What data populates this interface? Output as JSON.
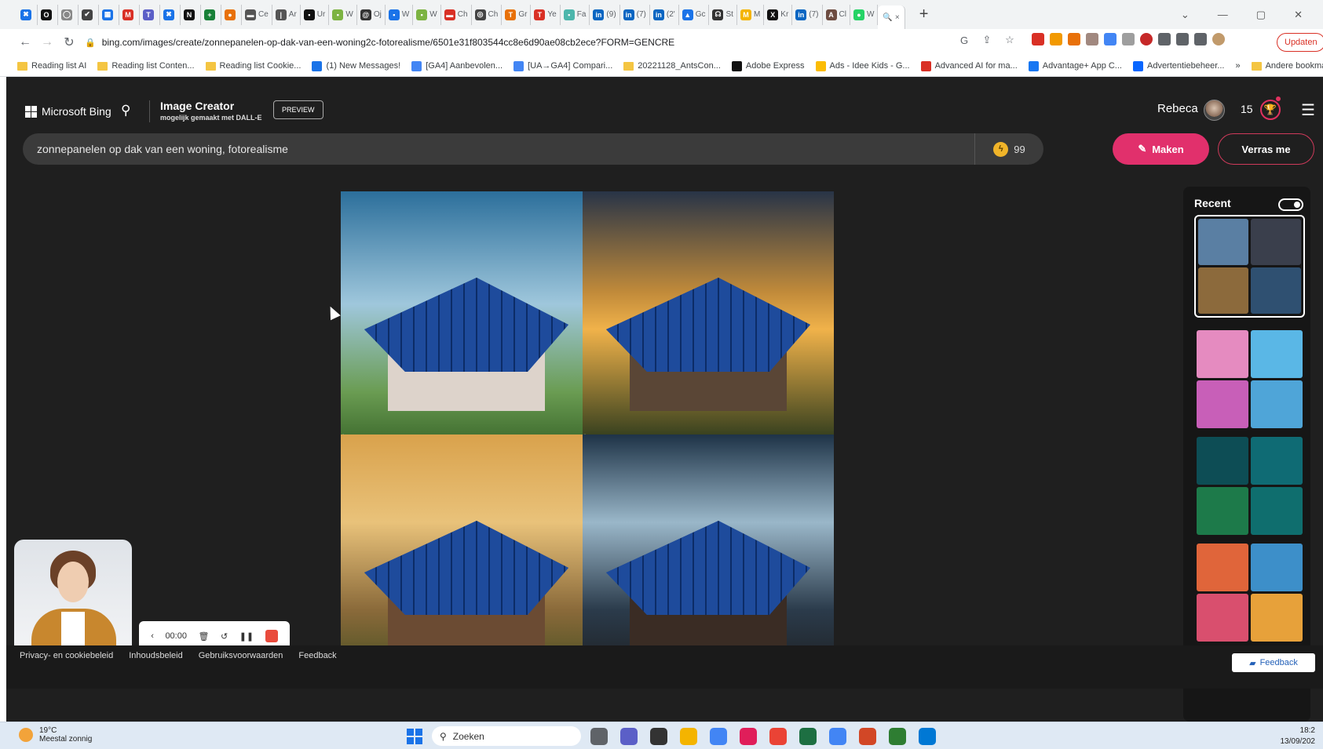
{
  "browser": {
    "tabs": [
      {
        "fav_color": "#1a73e8",
        "fav_glyph": "✖",
        "label": ""
      },
      {
        "fav_color": "#111",
        "fav_glyph": "O",
        "label": ""
      },
      {
        "fav_color": "#888",
        "fav_glyph": "◯",
        "label": ""
      },
      {
        "fav_color": "#444",
        "fav_glyph": "✔",
        "label": ""
      },
      {
        "fav_color": "#1a73e8",
        "fav_glyph": "▦",
        "label": ""
      },
      {
        "fav_color": "#d93025",
        "fav_glyph": "M",
        "label": ""
      },
      {
        "fav_color": "#5b5fc7",
        "fav_glyph": "T",
        "label": ""
      },
      {
        "fav_color": "#1a73e8",
        "fav_glyph": "✖",
        "label": ""
      },
      {
        "fav_color": "#111",
        "fav_glyph": "N",
        "label": ""
      },
      {
        "fav_color": "#188038",
        "fav_glyph": "+",
        "label": ""
      },
      {
        "fav_color": "#e8710a",
        "fav_glyph": "●",
        "label": ""
      },
      {
        "fav_color": "#555",
        "fav_glyph": "▬",
        "label": "Ce"
      },
      {
        "fav_color": "#555",
        "fav_glyph": "|",
        "label": "Ar"
      },
      {
        "fav_color": "#111",
        "fav_glyph": "▪",
        "label": "Ur"
      },
      {
        "fav_color": "#7cb342",
        "fav_glyph": "▪",
        "label": "W"
      },
      {
        "fav_color": "#333",
        "fav_glyph": "@",
        "label": "Oj"
      },
      {
        "fav_color": "#1a73e8",
        "fav_glyph": "▪",
        "label": "W"
      },
      {
        "fav_color": "#7cb342",
        "fav_glyph": "▪",
        "label": "W"
      },
      {
        "fav_color": "#d93025",
        "fav_glyph": "▬",
        "label": "Ch"
      },
      {
        "fav_color": "#444",
        "fav_glyph": "◎",
        "label": "Ch"
      },
      {
        "fav_color": "#e8710a",
        "fav_glyph": "T",
        "label": "Gr"
      },
      {
        "fav_color": "#d93025",
        "fav_glyph": "T",
        "label": "Ye"
      },
      {
        "fav_color": "#4db6ac",
        "fav_glyph": "▪",
        "label": "Fa"
      },
      {
        "fav_color": "#0a66c2",
        "fav_glyph": "in",
        "label": "(9)"
      },
      {
        "fav_color": "#0a66c2",
        "fav_glyph": "in",
        "label": "(7)"
      },
      {
        "fav_color": "#0a66c2",
        "fav_glyph": "in",
        "label": "(2'"
      },
      {
        "fav_color": "#1a73e8",
        "fav_glyph": "▲",
        "label": "Gc"
      },
      {
        "fav_color": "#333",
        "fav_glyph": "☊",
        "label": "St"
      },
      {
        "fav_color": "#f4b400",
        "fav_glyph": "M",
        "label": "M"
      },
      {
        "fav_color": "#111",
        "fav_glyph": "X",
        "label": "Kr"
      },
      {
        "fav_color": "#0a66c2",
        "fav_glyph": "in",
        "label": "(7)"
      },
      {
        "fav_color": "#6d4c41",
        "fav_glyph": "A",
        "label": "Cl"
      },
      {
        "fav_color": "#25d366",
        "fav_glyph": "●",
        "label": "W"
      }
    ],
    "active_tab": {
      "fav_glyph": "🔍",
      "label": "×"
    },
    "new_tab": "+",
    "url": "bing.com/images/create/zonnepanelen-op-dak-van-een-woning2c-fotorealisme/6501e31f803544cc8e6d90ae08cb2ece?FORM=GENCRE",
    "update_label": "Updaten",
    "bookmarks": [
      {
        "kind": "folder",
        "label": "Reading list AI"
      },
      {
        "kind": "folder",
        "label": "Reading list Conten..."
      },
      {
        "kind": "folder",
        "label": "Reading list Cookie..."
      },
      {
        "kind": "icon",
        "color": "#1a73e8",
        "label": "(1) New Messages!"
      },
      {
        "kind": "icon",
        "color": "#4285f4",
        "label": "[GA4] Aanbevolen..."
      },
      {
        "kind": "icon",
        "color": "#4285f4",
        "label": "[UA→GA4] Compari..."
      },
      {
        "kind": "folder",
        "label": "20221128_AntsCon..."
      },
      {
        "kind": "icon",
        "color": "#111",
        "label": "Adobe Express"
      },
      {
        "kind": "icon",
        "color": "#fbbc04",
        "label": "Ads - Idee Kids - G..."
      },
      {
        "kind": "icon",
        "color": "#d93025",
        "label": "Advanced AI for ma..."
      },
      {
        "kind": "icon",
        "color": "#1877f2",
        "label": "Advantage+ App C..."
      },
      {
        "kind": "icon",
        "color": "#0866ff",
        "label": "Advertentiebeheer..."
      },
      {
        "kind": "folder",
        "label": "Andere bookmar"
      }
    ],
    "bookmarks_more": "»"
  },
  "bing": {
    "brand": "Microsoft Bing",
    "product_title": "Image Creator",
    "product_subtitle": "mogelijk gemaakt met DALL-E",
    "preview_badge": "PREVIEW",
    "user_name": "Rebeca",
    "rewards_points": "15",
    "prompt_text": "zonnepanelen op dak van een woning, fotorealisme",
    "boosts": "99",
    "make_label": "Maken",
    "surprise_label": "Verras me",
    "images": [
      {
        "sky": "linear-gradient(#2c6f9b 0%,#9fc7dc 45%,#6a9c52 80%,#3e6b2e 100%)",
        "house": "#ddd3cb",
        "wm": "b"
      },
      {
        "sky": "linear-gradient(#283447 0%,#c08a3a 40%,#f0b24a 55%,#2d3a1c 100%)",
        "house": "#5a4636",
        "wm": "b"
      },
      {
        "sky": "linear-gradient(#d9a24c 0%,#e9c27a 35%,#8a6a3a 70%,#3e4b1e 100%)",
        "house": "#6b4b33",
        "wm": ""
      },
      {
        "sky": "linear-gradient(#1e3347 0%,#9ab7c9 35%,#2b3b4b 70%,#1b1b1b 100%)",
        "house": "#3a2c24",
        "wm": ""
      }
    ],
    "recent": {
      "title": "Recent",
      "sets": [
        {
          "colors": [
            "#5a7fa3",
            "#3a3f4c",
            "#8c6a3c",
            "#2f5071"
          ],
          "selected": true
        },
        {
          "colors": [
            "#e58bc0",
            "#5ab7e6",
            "#c85fb8",
            "#4fa5d8"
          ],
          "selected": false
        },
        {
          "colors": [
            "#0d4d55",
            "#0f6b74",
            "#1d7a4a",
            "#0f6e6e"
          ],
          "selected": false
        },
        {
          "colors": [
            "#e0653a",
            "#3d8fc9",
            "#d94f6e",
            "#e7a13a"
          ],
          "selected": false
        }
      ]
    },
    "footer_links": [
      "Privacy- en cookiebeleid",
      "Inhoudsbeleid",
      "Gebruiksvoorwaarden",
      "Feedback"
    ],
    "feedback_button": "Feedback"
  },
  "recorder": {
    "time": "00:00"
  },
  "taskbar": {
    "temperature": "19°C",
    "weather": "Meestal zonnig",
    "search_placeholder": "Zoeken",
    "time": "18:2",
    "date": "13/09/202",
    "apps": [
      "#5f6368",
      "#5b5fc7",
      "#333",
      "#f4b400",
      "#4285f4",
      "#e01e5a",
      "#ea4335",
      "#1d6f42",
      "#4285f4",
      "#d24726",
      "#2e7d32",
      "#0078d4"
    ]
  }
}
